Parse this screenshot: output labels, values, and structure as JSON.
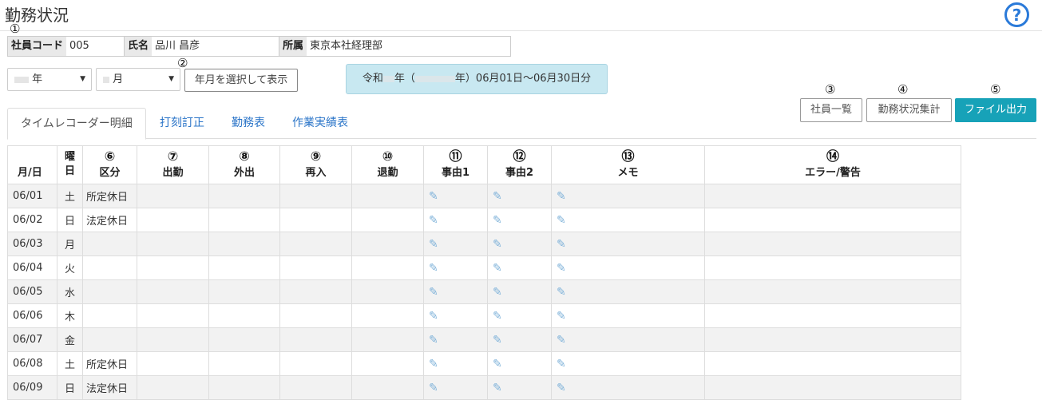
{
  "page": {
    "title": "勤務状況"
  },
  "annotations": [
    "①",
    "②",
    "③",
    "④",
    "⑤"
  ],
  "employee": {
    "code_label": "社員コード",
    "code": "005",
    "name_label": "氏名",
    "name": "品川 昌彦",
    "dept_label": "所属",
    "dept": "東京本社経理部"
  },
  "filter": {
    "year_suffix": "年",
    "month_suffix": "月",
    "show_button": "年月を選択して表示",
    "period_prefix": "令和",
    "period_mid": "年（",
    "period_suffix": "年）06月01日～06月30日分"
  },
  "toolbar": {
    "employee_list": "社員一覧",
    "summary": "勤務状況集計",
    "export": "ファイル出力"
  },
  "tabs": [
    "タイムレコーダー明細",
    "打刻訂正",
    "勤務表",
    "作業実績表"
  ],
  "table": {
    "headers": [
      {
        "num": "",
        "label": "月/日"
      },
      {
        "num": "",
        "label": "曜日"
      },
      {
        "num": "⑥",
        "label": "区分"
      },
      {
        "num": "⑦",
        "label": "出勤"
      },
      {
        "num": "⑧",
        "label": "外出"
      },
      {
        "num": "⑨",
        "label": "再入"
      },
      {
        "num": "⑩",
        "label": "退勤"
      },
      {
        "num": "⑪",
        "label": "事由1"
      },
      {
        "num": "⑫",
        "label": "事由2"
      },
      {
        "num": "⑬",
        "label": "メモ"
      },
      {
        "num": "⑭",
        "label": "エラー/警告"
      }
    ],
    "rows": [
      {
        "date": "06/01",
        "dow": "土",
        "type": "所定休日",
        "kind": "sat"
      },
      {
        "date": "06/02",
        "dow": "日",
        "type": "法定休日",
        "kind": "sun"
      },
      {
        "date": "06/03",
        "dow": "月",
        "type": "",
        "kind": "week"
      },
      {
        "date": "06/04",
        "dow": "火",
        "type": "",
        "kind": "week"
      },
      {
        "date": "06/05",
        "dow": "水",
        "type": "",
        "kind": "week"
      },
      {
        "date": "06/06",
        "dow": "木",
        "type": "",
        "kind": "week"
      },
      {
        "date": "06/07",
        "dow": "金",
        "type": "",
        "kind": "week"
      },
      {
        "date": "06/08",
        "dow": "土",
        "type": "所定休日",
        "kind": "sat"
      },
      {
        "date": "06/09",
        "dow": "日",
        "type": "法定休日",
        "kind": "sun"
      }
    ]
  }
}
